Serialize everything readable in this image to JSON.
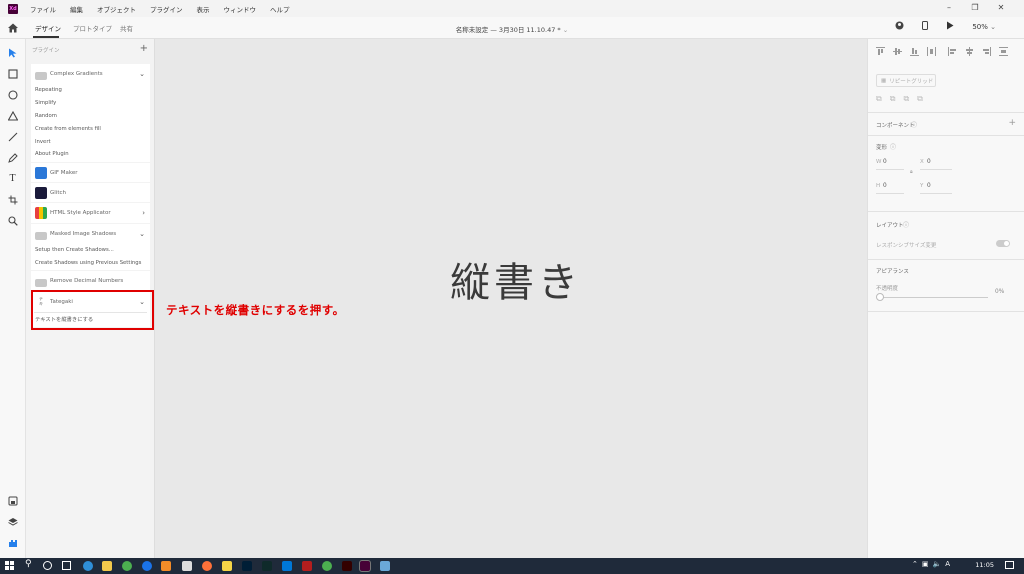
{
  "app": {
    "logo": "Xd"
  },
  "menu": [
    "ファイル",
    "編集",
    "オブジェクト",
    "プラグイン",
    "表示",
    "ウィンドウ",
    "ヘルプ"
  ],
  "tabs": {
    "design": "デザイン",
    "prototype": "プロトタイプ",
    "share": "共有"
  },
  "document": {
    "title": "名称未設定 — 3月30日 11.10.47 *"
  },
  "topbar": {
    "zoom": "50%"
  },
  "plugins": {
    "header": "プラグイン",
    "add": "+",
    "complex_gradients": {
      "name": "Complex Gradients",
      "items": [
        "Repeating",
        "Simplify",
        "Random",
        "Create from elements fill",
        "Invert",
        "About Plugin"
      ]
    },
    "gif_maker": {
      "name": "GIF Maker"
    },
    "glitch": {
      "name": "Glitch"
    },
    "html_style": {
      "name": "HTML Style Applicator"
    },
    "masked_shadows": {
      "name": "Masked Image Shadows",
      "items": [
        "Setup then Create Shadows...",
        "Create Shadows using Previous Settings"
      ]
    },
    "remove_decimal": {
      "name": "Remove Decimal Numbers"
    },
    "tategaki": {
      "name": "Tategaki",
      "items": [
        "テキストを縦書きにする"
      ]
    }
  },
  "annotation": "テキストを縦書きにするを押す。",
  "canvas": {
    "text": "縦書き"
  },
  "inspector": {
    "repeat_grid": "リピートグリッド",
    "component": "コンポーネント",
    "transform": "変形",
    "w_label": "W",
    "w_value": "0",
    "x_label": "X",
    "x_value": "0",
    "h_label": "H",
    "h_value": "0",
    "y_label": "Y",
    "y_value": "0",
    "layout": "レイアウト",
    "responsive_resize": "レスポンシブサイズ変更",
    "appearance": "アピアランス",
    "opacity_label": "不透明度",
    "opacity_value": "0%"
  },
  "taskbar": {
    "time": "11:05"
  },
  "colors": {
    "accent": "#2680eb",
    "highlight": "#e00000",
    "xd_brand": "#470137"
  }
}
